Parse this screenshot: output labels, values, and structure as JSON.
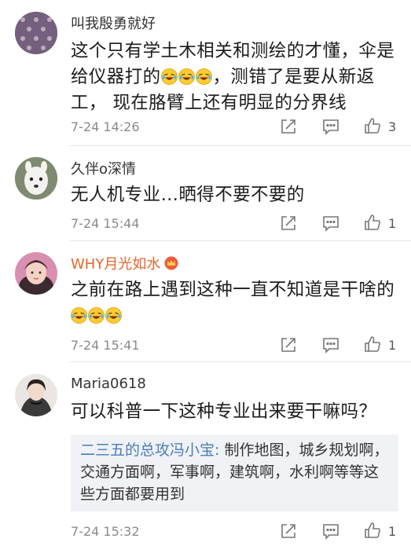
{
  "comments": [
    {
      "user": "叫我殷勇就好",
      "text_a": "这个只有学土木相关和测绘的才懂，伞是给仪器打的",
      "text_b": "，测错了是要从新返工， 现在胳臂上还有明显的分界线",
      "time": "7-24 14:26",
      "likes": "3"
    },
    {
      "user": "久伴o深情",
      "text": "无人机专业…晒得不要不要的",
      "time": "7-24 15:44",
      "likes": "1"
    },
    {
      "user": "WHY月光如水",
      "text_a": "之前在路上遇到这种一直不知道是干啥的",
      "time": "7-24 15:41",
      "likes": "1"
    },
    {
      "user": "Maria0618",
      "text": "可以科普一下这种专业出来要干嘛吗？",
      "reply_name": "二三五的总攻冯小宝:",
      "reply_text": " 制作地图，城乡规划啊，交通方面啊，军事啊，建筑啊，水利啊等等这些方面都要用到",
      "time": "7-24 15:32",
      "likes": "1"
    }
  ],
  "icons": {
    "share": "share-icon",
    "comment": "comment-icon",
    "like": "thumbs-up-icon",
    "emoji": "laughing-crying-emoji",
    "vip": "crown-badge-icon"
  },
  "colors": {
    "vip_name": "#e8642a",
    "reply_name": "#4a7db8",
    "reply_bg": "#f0f2f6"
  }
}
